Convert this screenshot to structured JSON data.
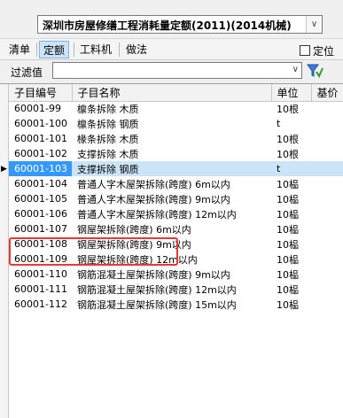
{
  "quota": {
    "selected": "深圳市房屋修缮工程消耗量定额(2011)(2014机械)"
  },
  "tabs": [
    {
      "label": "清单",
      "active": false
    },
    {
      "label": "定额",
      "active": true
    },
    {
      "label": "工料机",
      "active": false
    },
    {
      "label": "做法",
      "active": false
    }
  ],
  "locate": {
    "label": "定位",
    "checked": false
  },
  "filter": {
    "label": "过滤值",
    "value": ""
  },
  "grid": {
    "columns": [
      "子目编号",
      "子目名称",
      "单位",
      "基价"
    ],
    "rows": [
      {
        "code": "60001-99",
        "name": "檩条拆除 木质",
        "unit": "10根"
      },
      {
        "code": "60001-100",
        "name": "檩条拆除 钢质",
        "unit": "t"
      },
      {
        "code": "60001-101",
        "name": "椽条拆除 木质",
        "unit": "10根"
      },
      {
        "code": "60001-102",
        "name": "支撑拆除 木质",
        "unit": "10根"
      },
      {
        "code": "60001-103",
        "name": "支撑拆除 钢质",
        "unit": "t"
      },
      {
        "code": "60001-104",
        "name": "普通人字木屋架拆除(跨度) 6m以内",
        "unit": "10榀"
      },
      {
        "code": "60001-105",
        "name": "普通人字木屋架拆除(跨度) 9m以内",
        "unit": "10榀"
      },
      {
        "code": "60001-106",
        "name": "普通人字木屋架拆除(跨度) 12m以内",
        "unit": "10榀"
      },
      {
        "code": "60001-107",
        "name": "钢屋架拆除(跨度) 6m以内",
        "unit": "10榀"
      },
      {
        "code": "60001-108",
        "name": "钢屋架拆除(跨度) 9m以内",
        "unit": "10榀"
      },
      {
        "code": "60001-109",
        "name": "钢屋架拆除(跨度) 12m以内",
        "unit": "10榀"
      },
      {
        "code": "60001-110",
        "name": "钢筋混凝土屋架拆除(跨度) 9m以内",
        "unit": "10榀"
      },
      {
        "code": "60001-111",
        "name": "钢筋混凝土屋架拆除(跨度) 12m以内",
        "unit": "10榀"
      },
      {
        "code": "60001-112",
        "name": "钢筋混凝土屋架拆除(跨度) 15m以内",
        "unit": "10榀"
      }
    ],
    "selected_index": 4
  },
  "colors": {
    "selection": "#cce4f7",
    "annotation": "#e53935"
  }
}
